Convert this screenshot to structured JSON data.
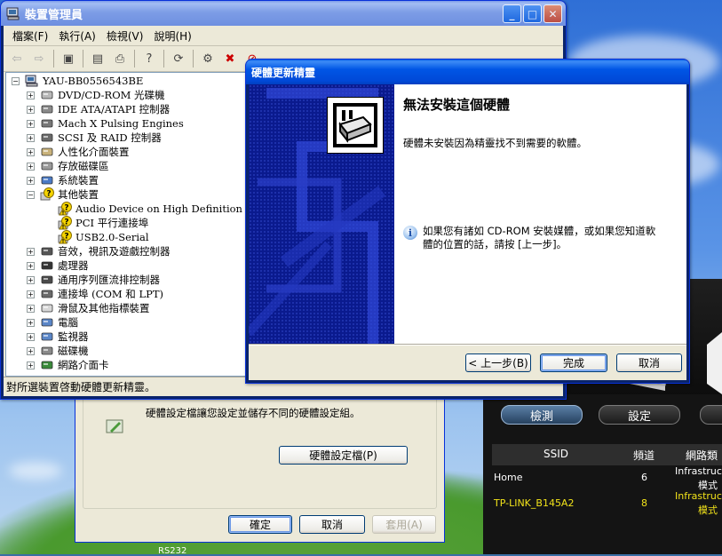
{
  "device_manager": {
    "title": "裝置管理員",
    "menu": [
      "檔案(F)",
      "執行(A)",
      "檢視(V)",
      "說明(H)"
    ],
    "root": "YAU-BB0556543BE",
    "tree": [
      {
        "label": "DVD/CD-ROM 光碟機",
        "expander": "+",
        "icon": "cd-drive-icon",
        "level": 1
      },
      {
        "label": "IDE ATA/ATAPI 控制器",
        "expander": "+",
        "icon": "ide-controller-icon",
        "level": 1
      },
      {
        "label": "Mach X Pulsing Engines",
        "expander": "+",
        "icon": "engine-device-icon",
        "level": 1
      },
      {
        "label": "SCSI 及 RAID 控制器",
        "expander": "+",
        "icon": "scsi-controller-icon",
        "level": 1
      },
      {
        "label": "人性化介面裝置",
        "expander": "+",
        "icon": "hid-device-icon",
        "level": 1
      },
      {
        "label": "存放磁碟區",
        "expander": "+",
        "icon": "storage-volume-icon",
        "level": 1
      },
      {
        "label": "系統裝置",
        "expander": "+",
        "icon": "system-device-icon",
        "level": 1
      },
      {
        "label": "其他裝置",
        "expander": "−",
        "icon": "unknown-device-icon",
        "level": 1
      },
      {
        "label": "Audio Device on High Definition Audio B",
        "expander": "",
        "icon": "warning-device-icon",
        "level": 2
      },
      {
        "label": "PCI 平行連接埠",
        "expander": "",
        "icon": "warning-device-icon",
        "level": 2
      },
      {
        "label": "USB2.0-Serial",
        "expander": "",
        "icon": "warning-device-icon",
        "level": 2
      },
      {
        "label": "音效，視訊及遊戲控制器",
        "expander": "+",
        "icon": "sound-device-icon",
        "level": 1
      },
      {
        "label": "處理器",
        "expander": "+",
        "icon": "processor-icon",
        "level": 1
      },
      {
        "label": "通用序列匯流排控制器",
        "expander": "+",
        "icon": "usb-controller-icon",
        "level": 1
      },
      {
        "label": "連接埠 (COM 和 LPT)",
        "expander": "+",
        "icon": "port-icon",
        "level": 1
      },
      {
        "label": "滑鼠及其他指標裝置",
        "expander": "+",
        "icon": "mouse-icon",
        "level": 1
      },
      {
        "label": "電腦",
        "expander": "+",
        "icon": "computer-icon",
        "level": 1
      },
      {
        "label": "監視器",
        "expander": "+",
        "icon": "monitor-icon",
        "level": 1
      },
      {
        "label": "磁碟機",
        "expander": "+",
        "icon": "disk-drive-icon",
        "level": 1
      },
      {
        "label": "網路介面卡",
        "expander": "+",
        "icon": "network-adapter-icon",
        "level": 1
      }
    ],
    "status": "對所選裝置啓動硬體更新精靈。"
  },
  "hardware_profiles": {
    "description": "硬體設定檔讓您設定並儲存不同的硬體設定組。",
    "profiles_button": "硬體設定檔(P)",
    "ok": "確定",
    "cancel": "取消",
    "apply": "套用(A)"
  },
  "router_app": {
    "buttons": [
      "檢測",
      "設定"
    ],
    "columns": [
      "SSID",
      "頻道",
      "網路類"
    ],
    "rows": [
      {
        "ssid": "Home",
        "channel": "6",
        "type": "Infrastruc",
        "type2": "模式",
        "color": "#ffffff"
      },
      {
        "ssid": "TP-LINK_B145A2",
        "channel": "8",
        "type": "Infrastruc",
        "type2": "模式",
        "color": "#f2e31a"
      }
    ]
  },
  "wizard": {
    "title": "硬體更新精靈",
    "heading": "無法安裝這個硬體",
    "message": "硬體未安裝因為精靈找不到需要的軟體。",
    "info_line1": "如果您有諸如 CD-ROM 安裝媒體，或如果您知道軟",
    "info_line2": "體的位置的話，請按 [上一步]。",
    "back": "< 上一步(B)",
    "finish": "完成",
    "cancel": "取消"
  },
  "taskbar_text": "RS232"
}
